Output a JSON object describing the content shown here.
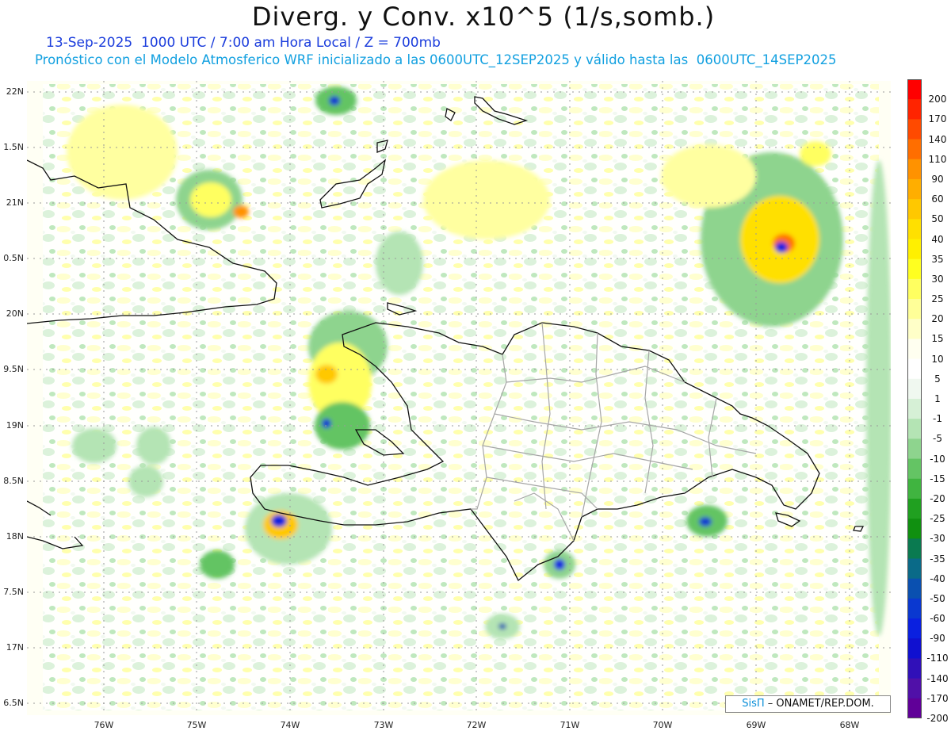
{
  "header": {
    "title": "Diverg. y Conv. x10^5 (1/s,somb.)",
    "subtitle_1": "13-Sep-2025  1000 UTC / 7:00 am Hora Local / Z = 700mb",
    "subtitle_2": "Pronóstico con el Modelo Atmosferico WRF inicializado a las 0600UTC_12SEP2025 y válido hasta las  0600UTC_14SEP2025"
  },
  "axes": {
    "lat_labels": [
      "22N",
      "1.5N",
      "21N",
      "0.5N",
      "20N",
      "9.5N",
      "19N",
      "8.5N",
      "18N",
      "7.5N",
      "17N",
      "6.5N"
    ],
    "lon_labels": [
      "76W",
      "75W",
      "74W",
      "73W",
      "72W",
      "71W",
      "70W",
      "69W",
      "68W"
    ]
  },
  "colorbar": {
    "labels": [
      "200",
      "170",
      "140",
      "110",
      "90",
      "60",
      "50",
      "40",
      "35",
      "30",
      "25",
      "20",
      "15",
      "10",
      "5",
      "1",
      "-1",
      "-5",
      "-10",
      "-15",
      "-20",
      "-25",
      "-30",
      "-35",
      "-40",
      "-50",
      "-60",
      "-90",
      "-110",
      "-140",
      "-170",
      "-200"
    ],
    "colors": [
      "#ff0000",
      "#ff2400",
      "#ff4a00",
      "#ff6e00",
      "#ff9200",
      "#ffae00",
      "#ffc800",
      "#ffe000",
      "#fff000",
      "#ffff20",
      "#ffff60",
      "#ffff98",
      "#ffffc8",
      "#fffff0",
      "#ffffff",
      "#f0f8f0",
      "#d6f0d6",
      "#b4e4b4",
      "#8ed48e",
      "#64c464",
      "#40b440",
      "#20a020",
      "#109010",
      "#0a7a50",
      "#0a6a88",
      "#0a50b0",
      "#0a38d0",
      "#0a20e0",
      "#1010d0",
      "#3010b8",
      "#5010a8",
      "#600098"
    ]
  },
  "credit": {
    "sis": "SisΠ",
    "org": "ONAMET/REP.DOM."
  }
}
